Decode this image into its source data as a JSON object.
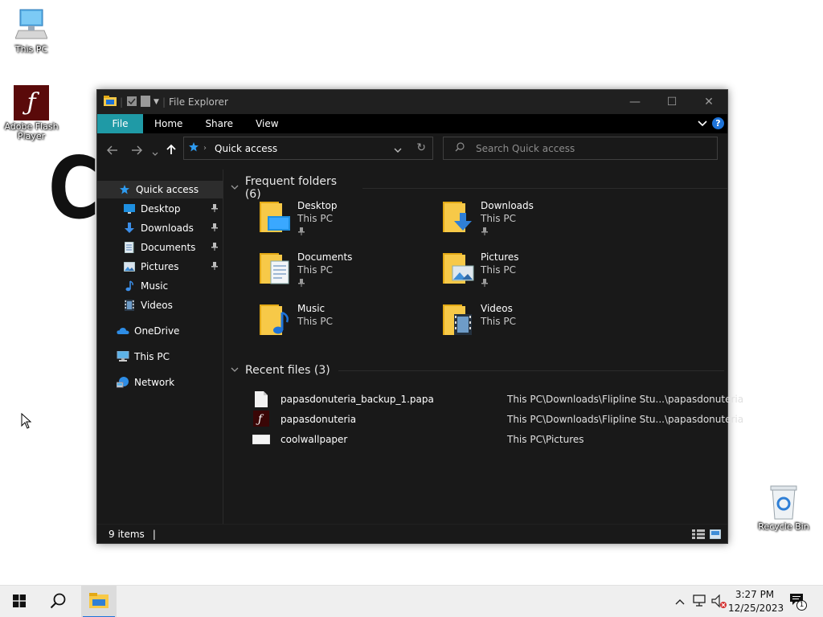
{
  "desktop": {
    "icons": [
      {
        "label": "This PC"
      },
      {
        "label": "Adobe Flash Player"
      },
      {
        "label": "Recycle Bin"
      }
    ],
    "big_letter": "C"
  },
  "window": {
    "title": "File Explorer",
    "controls": {
      "minimize": "—",
      "maximize": "☐",
      "close": "✕"
    }
  },
  "ribbon": {
    "tabs": [
      "File",
      "Home",
      "Share",
      "View"
    ],
    "help": "?"
  },
  "address": {
    "location": "Quick access",
    "search_placeholder": "Search Quick access"
  },
  "sidebar": {
    "items": [
      {
        "label": "Quick access",
        "icon": "star-icon"
      },
      {
        "label": "Desktop",
        "icon": "desktop-icon",
        "pinned": true
      },
      {
        "label": "Downloads",
        "icon": "download-icon",
        "pinned": true
      },
      {
        "label": "Documents",
        "icon": "documents-icon",
        "pinned": true
      },
      {
        "label": "Pictures",
        "icon": "pictures-icon",
        "pinned": true
      },
      {
        "label": "Music",
        "icon": "music-icon"
      },
      {
        "label": "Videos",
        "icon": "videos-icon"
      },
      {
        "label": "OneDrive",
        "icon": "cloud-icon"
      },
      {
        "label": "This PC",
        "icon": "computer-icon"
      },
      {
        "label": "Network",
        "icon": "network-icon"
      }
    ]
  },
  "main": {
    "frequent_header": "Frequent folders (6)",
    "recent_header": "Recent files (3)",
    "folders": [
      {
        "name": "Desktop",
        "location": "This PC",
        "pinned": true,
        "overlay": "desktop"
      },
      {
        "name": "Downloads",
        "location": "This PC",
        "pinned": true,
        "overlay": "download"
      },
      {
        "name": "Documents",
        "location": "This PC",
        "pinned": true,
        "overlay": "document"
      },
      {
        "name": "Pictures",
        "location": "This PC",
        "pinned": true,
        "overlay": "picture"
      },
      {
        "name": "Music",
        "location": "This PC",
        "pinned": false,
        "overlay": "music"
      },
      {
        "name": "Videos",
        "location": "This PC",
        "pinned": false,
        "overlay": "video"
      }
    ],
    "recent_files": [
      {
        "name": "papasdonuteria_backup_1.papa",
        "path": "This PC\\Downloads\\Flipline Stu...\\papasdonuteria",
        "icon": "blank-file-icon"
      },
      {
        "name": "papasdonuteria",
        "path": "This PC\\Downloads\\Flipline Stu...\\papasdonuteria",
        "icon": "flash-file-icon"
      },
      {
        "name": "coolwallpaper",
        "path": "This PC\\Pictures",
        "icon": "image-file-icon"
      }
    ]
  },
  "status": {
    "item_count": "9 items",
    "separator": "|"
  },
  "taskbar": {
    "time": "3:27 PM",
    "date": "12/25/2023",
    "notification_count": "1"
  },
  "colors": {
    "accent_file_tab": "#1f9aa6",
    "folder_yellow": "#f7c948",
    "window_bg": "#191919"
  }
}
